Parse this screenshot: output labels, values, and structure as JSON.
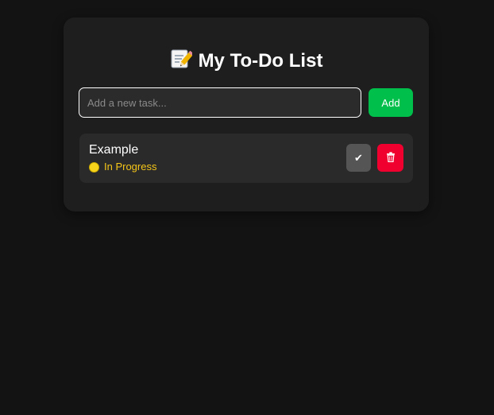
{
  "app": {
    "title": "My To-Do List",
    "title_icon": "memo-pencil-icon"
  },
  "new_task": {
    "placeholder": "Add a new task...",
    "value": "",
    "add_label": "Add"
  },
  "tasks": [
    {
      "name": "Example",
      "status": "In Progress",
      "status_icon": "yellow-circle-icon",
      "done_glyph": "✔",
      "delete_icon": "trash-icon"
    }
  ],
  "colors": {
    "background": "#131313",
    "card": "#1e1e1e",
    "add_button": "#00c04b",
    "delete_button": "#f0002f",
    "done_button": "#555555",
    "status_text": "#f5c518"
  }
}
